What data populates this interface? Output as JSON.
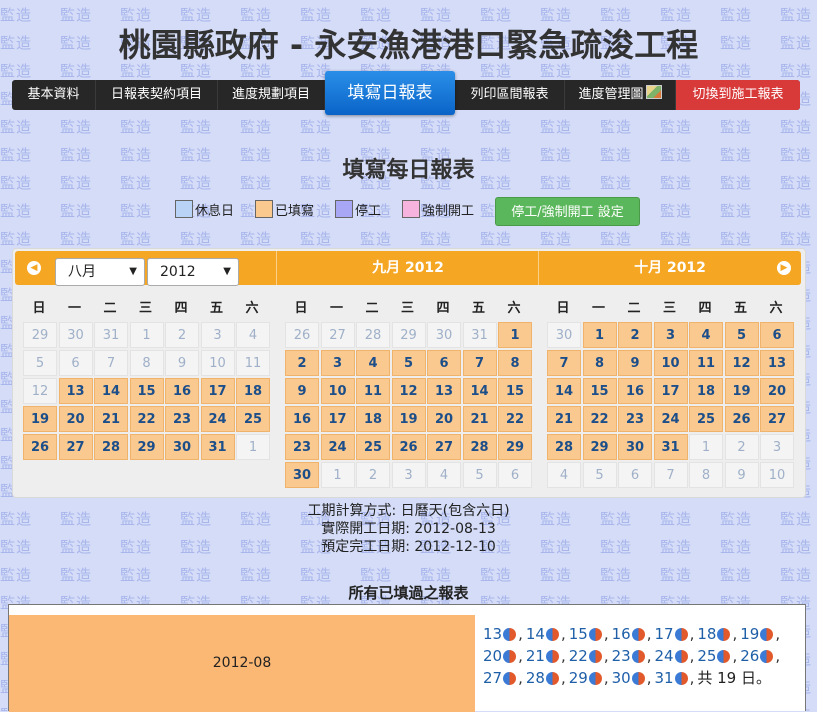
{
  "watermark": "監造",
  "title": "桃園縣政府 - 永安漁港港口緊急疏浚工程",
  "nav": {
    "items": [
      "基本資料",
      "日報表契約項目",
      "進度規劃項目",
      "填寫日報表",
      "列印區間報表",
      "進度管理圖",
      "切換到施工報表"
    ],
    "active_index": 3
  },
  "subtitle": "填寫每日報表",
  "legend": [
    {
      "label": "休息日",
      "color": "#b9d3f7"
    },
    {
      "label": "已填寫",
      "color": "#fac98f"
    },
    {
      "label": "停工",
      "color": "#a7a7f5"
    },
    {
      "label": "強制開工",
      "color": "#f6b3de"
    }
  ],
  "setting_button": "停工/強制開工 設定",
  "calendar": {
    "month_select": "八月",
    "year_select": "2012",
    "month2_title": "九月 2012",
    "month3_title": "十月 2012",
    "weekdays": [
      "日",
      "一",
      "二",
      "三",
      "四",
      "五",
      "六"
    ],
    "months": [
      {
        "days": [
          [
            29,
            0,
            0
          ],
          [
            30,
            0,
            0
          ],
          [
            31,
            0,
            0
          ],
          [
            1,
            0,
            1
          ],
          [
            2,
            0,
            1
          ],
          [
            3,
            0,
            1
          ],
          [
            4,
            0,
            1
          ],
          [
            5,
            0,
            1
          ],
          [
            6,
            0,
            1
          ],
          [
            7,
            0,
            1
          ],
          [
            8,
            0,
            1
          ],
          [
            9,
            0,
            1
          ],
          [
            10,
            0,
            1
          ],
          [
            11,
            0,
            1
          ],
          [
            12,
            0,
            1
          ],
          [
            13,
            1,
            1
          ],
          [
            14,
            1,
            1
          ],
          [
            15,
            1,
            1
          ],
          [
            16,
            1,
            1
          ],
          [
            17,
            1,
            1
          ],
          [
            18,
            1,
            1
          ],
          [
            19,
            1,
            1
          ],
          [
            20,
            1,
            1
          ],
          [
            21,
            1,
            1
          ],
          [
            22,
            1,
            1
          ],
          [
            23,
            1,
            1
          ],
          [
            24,
            1,
            1
          ],
          [
            25,
            1,
            1
          ],
          [
            26,
            1,
            1
          ],
          [
            27,
            1,
            1
          ],
          [
            28,
            1,
            1
          ],
          [
            29,
            1,
            1
          ],
          [
            30,
            1,
            1
          ],
          [
            31,
            1,
            1
          ],
          [
            1,
            0,
            0
          ]
        ]
      },
      {
        "days": [
          [
            26,
            0,
            0
          ],
          [
            27,
            0,
            0
          ],
          [
            28,
            0,
            0
          ],
          [
            29,
            0,
            0
          ],
          [
            30,
            0,
            0
          ],
          [
            31,
            0,
            0
          ],
          [
            1,
            1,
            1
          ],
          [
            2,
            1,
            1
          ],
          [
            3,
            1,
            1
          ],
          [
            4,
            1,
            1
          ],
          [
            5,
            1,
            1
          ],
          [
            6,
            1,
            1
          ],
          [
            7,
            1,
            1
          ],
          [
            8,
            1,
            1
          ],
          [
            9,
            1,
            1
          ],
          [
            10,
            1,
            1
          ],
          [
            11,
            1,
            1
          ],
          [
            12,
            1,
            1
          ],
          [
            13,
            1,
            1
          ],
          [
            14,
            1,
            1
          ],
          [
            15,
            1,
            1
          ],
          [
            16,
            1,
            1
          ],
          [
            17,
            1,
            1
          ],
          [
            18,
            1,
            1
          ],
          [
            19,
            1,
            1
          ],
          [
            20,
            1,
            1
          ],
          [
            21,
            1,
            1
          ],
          [
            22,
            1,
            1
          ],
          [
            23,
            1,
            1
          ],
          [
            24,
            1,
            1
          ],
          [
            25,
            1,
            1
          ],
          [
            26,
            1,
            1
          ],
          [
            27,
            1,
            1
          ],
          [
            28,
            1,
            1
          ],
          [
            29,
            1,
            1
          ],
          [
            30,
            1,
            1
          ],
          [
            1,
            0,
            0
          ],
          [
            2,
            0,
            0
          ],
          [
            3,
            0,
            0
          ],
          [
            4,
            0,
            0
          ],
          [
            5,
            0,
            0
          ],
          [
            6,
            0,
            0
          ]
        ]
      },
      {
        "days": [
          [
            30,
            0,
            0
          ],
          [
            1,
            1,
            1
          ],
          [
            2,
            1,
            1
          ],
          [
            3,
            1,
            1
          ],
          [
            4,
            1,
            1
          ],
          [
            5,
            1,
            1
          ],
          [
            6,
            1,
            1
          ],
          [
            7,
            1,
            1
          ],
          [
            8,
            1,
            1
          ],
          [
            9,
            1,
            1
          ],
          [
            10,
            1,
            1
          ],
          [
            11,
            1,
            1
          ],
          [
            12,
            1,
            1
          ],
          [
            13,
            1,
            1
          ],
          [
            14,
            1,
            1
          ],
          [
            15,
            1,
            1
          ],
          [
            16,
            1,
            1
          ],
          [
            17,
            1,
            1
          ],
          [
            18,
            1,
            1
          ],
          [
            19,
            1,
            1
          ],
          [
            20,
            1,
            1
          ],
          [
            21,
            1,
            1
          ],
          [
            22,
            1,
            1
          ],
          [
            23,
            1,
            1
          ],
          [
            24,
            1,
            1
          ],
          [
            25,
            1,
            1
          ],
          [
            26,
            1,
            1
          ],
          [
            27,
            1,
            1
          ],
          [
            28,
            1,
            1
          ],
          [
            29,
            1,
            1
          ],
          [
            30,
            1,
            1
          ],
          [
            31,
            1,
            1
          ],
          [
            1,
            0,
            0
          ],
          [
            2,
            0,
            0
          ],
          [
            3,
            0,
            0
          ],
          [
            4,
            0,
            0
          ],
          [
            5,
            0,
            0
          ],
          [
            6,
            0,
            0
          ],
          [
            7,
            0,
            0
          ],
          [
            8,
            0,
            0
          ],
          [
            9,
            0,
            0
          ],
          [
            10,
            0,
            0
          ]
        ]
      }
    ]
  },
  "info": {
    "calc_method": "工期計算方式: 日曆天(包含六日)",
    "actual_start": "實際開工日期: 2012-08-13",
    "planned_end": "預定完工日期: 2012-12-10"
  },
  "reports_title": "所有已填過之報表",
  "reports": {
    "month": "2012-08",
    "days": [
      13,
      14,
      15,
      16,
      17,
      18,
      19,
      20,
      21,
      22,
      23,
      24,
      25,
      26,
      27,
      28,
      29,
      30,
      31
    ],
    "total": "共 19 日。"
  }
}
